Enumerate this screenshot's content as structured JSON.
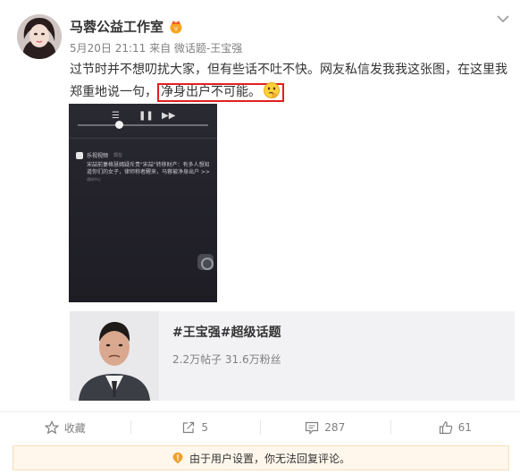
{
  "author": {
    "name": "马蓉公益工作室",
    "avatar_icon": "user-avatar",
    "badge_icon": "vip-badge-icon"
  },
  "post": {
    "meta": "5月20日 21:11 来自 微话题-王宝强",
    "text_part1": "过节时并不想叨扰大家，但有些话不吐不快。网友私信发我我这张图，在这里我郑重地说一句，",
    "text_highlight": "净身出户不可能。",
    "emoji_icon": "thinking-emoji-icon"
  },
  "screenshot": {
    "notif_app": "乐视视频",
    "notif_time": "现在",
    "notif_body": "宋喆前妻格慧嫣疑斥责\"宋喆\"转移财产：有多人想知道你们的女子，律师称者醒来，马蓉被净身出户 >>",
    "notif_sub": "通知中心"
  },
  "topic": {
    "title": "#王宝强#超级话题",
    "stats": "2.2万帖子 31.6万粉丝"
  },
  "actions": {
    "favorite": "收藏",
    "repost": "5",
    "comment": "287",
    "like": "61"
  },
  "notice": {
    "text": "由于用户设置，你无法回复评论。"
  },
  "colors": {
    "highlight_border": "#e02020",
    "notice_bg": "#fff7ec",
    "notice_icon": "#f0a030"
  }
}
